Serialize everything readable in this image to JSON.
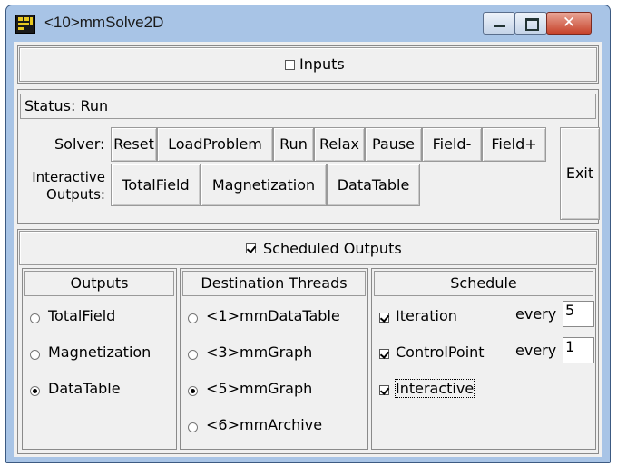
{
  "window": {
    "title": "<10>mmSolve2D"
  },
  "inputs": {
    "label": "Inputs",
    "checked": false
  },
  "status": {
    "text": "Status: Run"
  },
  "solver": {
    "label": "Solver:",
    "buttons": [
      "Reset",
      "LoadProblem",
      "Run",
      "Relax",
      "Pause",
      "Field-",
      "Field+"
    ],
    "exit_label": "Exit"
  },
  "interactive": {
    "label_line1": "Interactive",
    "label_line2": "Outputs:",
    "buttons": [
      "TotalField",
      "Magnetization",
      "DataTable"
    ]
  },
  "scheduled": {
    "label": "Scheduled Outputs",
    "checked": true,
    "outputs": {
      "header": "Outputs",
      "items": [
        "TotalField",
        "Magnetization",
        "DataTable"
      ],
      "selected": "DataTable"
    },
    "destinations": {
      "header": "Destination Threads",
      "items": [
        "<1>mmDataTable",
        "<3>mmGraph",
        "<5>mmGraph",
        "<6>mmArchive"
      ],
      "selected": "<5>mmGraph"
    },
    "schedule": {
      "header": "Schedule",
      "events": [
        {
          "label": "Iteration",
          "checked": true,
          "every_label": "every",
          "every_value": "5"
        },
        {
          "label": "ControlPoint",
          "checked": true,
          "every_label": "every",
          "every_value": "1"
        },
        {
          "label": "Interactive",
          "checked": true
        }
      ]
    }
  }
}
